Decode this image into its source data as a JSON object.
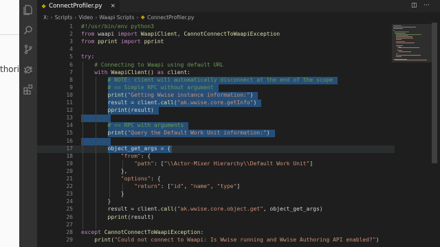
{
  "background_page": {
    "partial_text": "thorin"
  },
  "editor": {
    "tab_label": "ConnectProfiler.py",
    "tab_icon": "python-icon",
    "close_glyph": "×",
    "breadcrumb": [
      "X:",
      "Scripts",
      "Video",
      "Waapi Scripts",
      "ConnectProfiler.py"
    ],
    "breadcrumb_sep": "›",
    "lines": [
      {
        "n": "1",
        "t": "#!/usr/bin/env python3"
      },
      {
        "n": "2",
        "t": "from waapi import WaapiClient, CannotConnectToWaapiException"
      },
      {
        "n": "3",
        "t": "from pprint import pprint"
      },
      {
        "n": "4",
        "t": ""
      },
      {
        "n": "5",
        "t": "try:"
      },
      {
        "n": "6",
        "t": "    # Connecting to Waapi using default URL"
      },
      {
        "n": "7",
        "t": "    with WaapiClient() as client:"
      },
      {
        "n": "8",
        "t": "        # NOTE: client will automatically disconnect at the end of the scope"
      },
      {
        "n": "9",
        "t": "        # == Simple RPC without argument"
      },
      {
        "n": "10",
        "t": "        print(\"Getting Wwise instance information:\")"
      },
      {
        "n": "11",
        "t": "        result = client.call(\"ak.wwise.core.getInfo\")"
      },
      {
        "n": "12",
        "t": "        pprint(result)"
      },
      {
        "n": "13",
        "t": ""
      },
      {
        "n": "14",
        "t": "        # == RPC with arguments"
      },
      {
        "n": "15",
        "t": "        print(\"Query the Default Work Unit information:\")"
      },
      {
        "n": "16",
        "t": ""
      },
      {
        "n": "17",
        "t": "        object_get_args = {"
      },
      {
        "n": "18",
        "t": "            \"from\": {"
      },
      {
        "n": "19",
        "t": "                \"path\": [\"\\\\Actor-Mixer Hierarchy\\\\Default Work Unit\"]"
      },
      {
        "n": "20",
        "t": "            },"
      },
      {
        "n": "21",
        "t": "            \"options\": {"
      },
      {
        "n": "22",
        "t": "                \"return\": [\"id\", \"name\", \"type\"]"
      },
      {
        "n": "23",
        "t": "            }"
      },
      {
        "n": "24",
        "t": "        }"
      },
      {
        "n": "25",
        "t": "        result = client.call(\"ak.wwise.core.object.get\", object_get_args)"
      },
      {
        "n": "26",
        "t": "        pprint(result)"
      },
      {
        "n": "27",
        "t": ""
      },
      {
        "n": "28",
        "t": "except CannotConnectToWaapiException:"
      },
      {
        "n": "29",
        "t": "    print(\"Could not connect to Waapi: Is Wwise running and Wwise Authoring API enabled?\")"
      }
    ],
    "selection": {
      "from_line": 8,
      "to_line": 17
    }
  },
  "activity_bar": [
    {
      "icon": "files-icon"
    },
    {
      "icon": "search-icon"
    },
    {
      "icon": "source-control-icon"
    },
    {
      "icon": "debug-icon"
    },
    {
      "icon": "extensions-icon"
    }
  ],
  "window_controls": [
    "split-editor-icon",
    "more-actions-icon"
  ],
  "colors": {
    "keyword": "#c586c0",
    "function": "#dcdcaa",
    "string": "#ce9178",
    "comment": "#6a9955",
    "selection": "#264f78"
  }
}
